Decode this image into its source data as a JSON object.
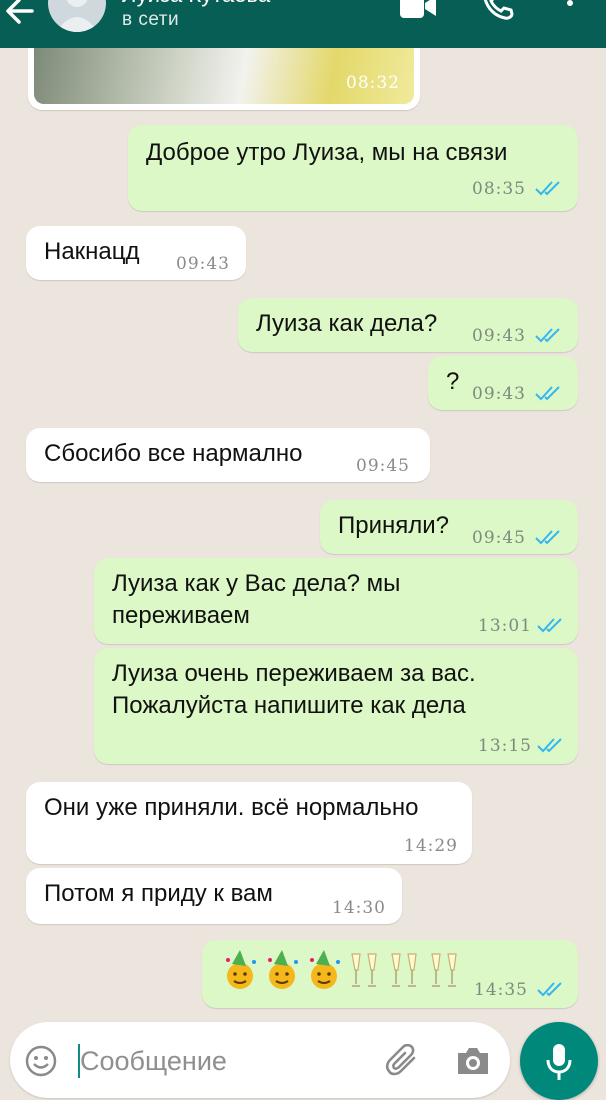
{
  "header": {
    "contact_name": "Луиза Кутаева",
    "status": "в сети",
    "icons": [
      "back-arrow-icon",
      "video-call-icon",
      "voice-call-icon",
      "menu-icon"
    ]
  },
  "messages": [
    {
      "dir": "in",
      "type": "image",
      "time": "08:32"
    },
    {
      "dir": "out",
      "text": "Доброе утро  Луиза,  мы на связи",
      "time": "08:35",
      "ticks": "read"
    },
    {
      "dir": "in",
      "text": "Накнацд",
      "time": "09:43"
    },
    {
      "dir": "out",
      "text": "Луиза как дела?",
      "time": "09:43",
      "ticks": "read"
    },
    {
      "dir": "out",
      "text": "?",
      "time": "09:43",
      "ticks": "read"
    },
    {
      "dir": "in",
      "text": "Сбосибо все  нармално",
      "time": "09:45"
    },
    {
      "dir": "out",
      "text": "Приняли?",
      "time": "09:45",
      "ticks": "read"
    },
    {
      "dir": "out",
      "text_lines": [
        "Луиза как у Вас дела? мы",
        "переживаем"
      ],
      "time": "13:01",
      "ticks": "read"
    },
    {
      "dir": "out",
      "text_lines": [
        "Луиза очень переживаем за вас.",
        "Пожалуйста напишите как дела"
      ],
      "time": "13:15",
      "ticks": "read"
    },
    {
      "dir": "in",
      "text": "Они уже приняли. всё нормально",
      "time": "14:29"
    },
    {
      "dir": "in",
      "text": "Потом  я приду к вам",
      "time": "14:30"
    },
    {
      "dir": "out",
      "type": "emoji",
      "emoji": [
        "partying-face",
        "partying-face",
        "partying-face",
        "champagne-glasses",
        "champagne-glasses",
        "champagne-glasses"
      ],
      "time": "14:35",
      "ticks": "read"
    }
  ],
  "input": {
    "placeholder": "Сообщение",
    "icons": [
      "emoji-icon",
      "attach-icon",
      "camera-icon",
      "mic-icon"
    ]
  },
  "colors": {
    "header": "#075e54",
    "background": "#ece5dd",
    "incoming": "#ffffff",
    "outgoing": "#dcf8c6",
    "read_ticks": "#34b7f1",
    "mic": "#00897b"
  }
}
